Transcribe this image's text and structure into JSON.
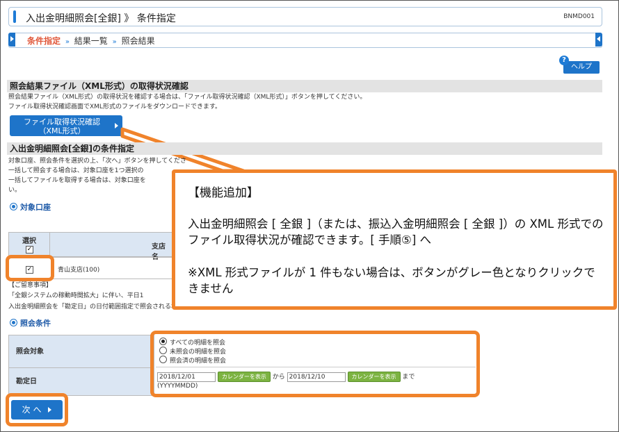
{
  "header": {
    "title": "入出金明細照会[全銀] 》 条件指定",
    "screen_code": "BNMD001"
  },
  "steps": {
    "current": "条件指定",
    "separator": "»",
    "step2": "結果一覧",
    "step3": "照会結果"
  },
  "help": {
    "icon": "?",
    "label": "ヘルプ"
  },
  "xml_section": {
    "title": "照会結果ファイル（XML形式）の取得状況確認",
    "desc1": "照会結果ファイル（XML形式）の取得状況を確認する場合は、「ファイル取得状況確認（XML形式）」ボタンを押してください。",
    "desc2": "ファイル取得状況確認画面でXML形式のファイルをダウンロードできます。",
    "button_line1": "ファイル取得状況確認",
    "button_line2": "（XML形式）"
  },
  "condition_section": {
    "title": "入出金明細照会[全銀]の条件指定",
    "desc1": "対象口座、照会条件を選択の上、「次へ」ボタンを押してくださ",
    "desc2": "一括して照会する場合は、対象口座を1つ選択の",
    "desc3": "一括してファイルを取得する場合は、対象口座を",
    "desc4": "い。"
  },
  "account": {
    "heading": "対象口座",
    "col_select": "選択",
    "col_branch": "支店名",
    "row_branch": "青山支店(100)",
    "row_checked": true
  },
  "notes": {
    "heading": "【ご留意事項】",
    "line1": "「全銀システムの稼動時間拡大」に伴い、平日1",
    "line2": "入出金明細照会を「勘定日」の日付範囲指定で照会される場合、ご留意ください。"
  },
  "query_conditions": {
    "heading": "照会条件",
    "target_label": "照会対象",
    "options": [
      "すべての明細を照会",
      "未照会の明細を照会",
      "照会済の明細を照会"
    ],
    "selected_index": 0,
    "date_label": "勘定日",
    "date_from": "2018/12/01",
    "date_to": "2018/12/10",
    "calendar_button": "カレンダーを表示",
    "from_text": "から",
    "to_text": "まで",
    "format_hint": "(YYYYMMDD)"
  },
  "next_button": "次 へ",
  "callout": {
    "tag": "【機能追加】",
    "body1": "入出金明細照会 [ 全銀 ]（または、振込入金明細照会 [ 全銀 ]）の XML 形式でのファイル取得状況が確認できます。[ 手順⑤] へ",
    "body2": "※XML 形式ファイルが 1 件もない場合は、ボタンがグレー色となりクリックできません"
  },
  "colors": {
    "accent_blue": "#1e74c9",
    "highlight_orange": "#f0832b",
    "current_step": "#e0573a"
  }
}
